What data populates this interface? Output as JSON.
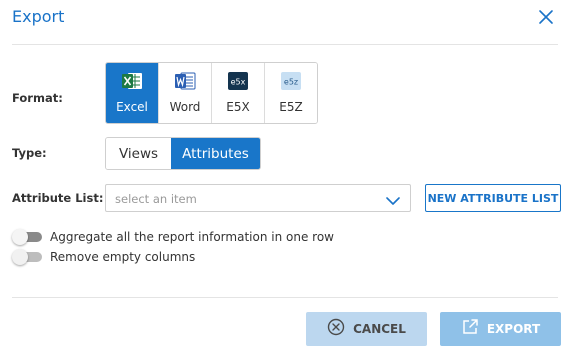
{
  "dialog": {
    "title": "Export"
  },
  "format": {
    "label": "Format:",
    "options": [
      {
        "label": "Excel",
        "icon": "excel-icon",
        "selected": true
      },
      {
        "label": "Word",
        "icon": "word-icon",
        "selected": false
      },
      {
        "label": "E5X",
        "icon": "e5x-icon",
        "icon_text": "e5x",
        "selected": false
      },
      {
        "label": "E5Z",
        "icon": "e5z-icon",
        "icon_text": "e5z",
        "selected": false
      }
    ]
  },
  "type": {
    "label": "Type:",
    "options": [
      {
        "label": "Views",
        "selected": false
      },
      {
        "label": "Attributes",
        "selected": true
      }
    ]
  },
  "attribute_list": {
    "label": "Attribute List:",
    "placeholder": "select an item",
    "new_button_label": "NEW ATTRIBUTE LIST"
  },
  "toggles": [
    {
      "label": "Aggregate all the report information in one row",
      "on": false
    },
    {
      "label": "Remove empty columns",
      "on": false
    }
  ],
  "footer": {
    "cancel_label": "CANCEL",
    "export_label": "EXPORT"
  },
  "colors": {
    "accent": "#1976c9",
    "title": "#1a73c8",
    "cancel_bg": "#bcd7ef",
    "export_bg": "#8fc1e8"
  }
}
